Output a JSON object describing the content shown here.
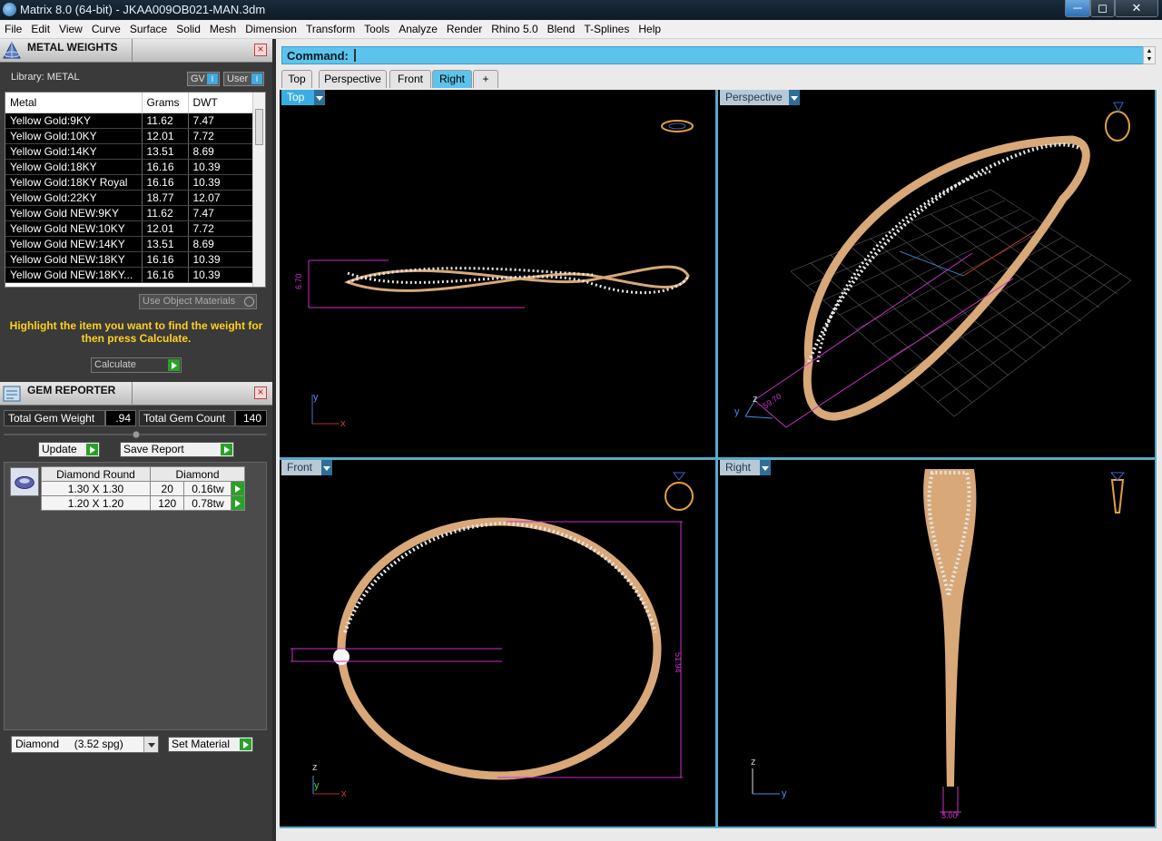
{
  "window": {
    "title": "Matrix 8.0 (64-bit) - JKAA009OB021-MAN.3dm",
    "controls": {
      "minimize": "─",
      "maximize": "◻",
      "close": "✕"
    }
  },
  "menu": [
    "File",
    "Edit",
    "View",
    "Curve",
    "Surface",
    "Solid",
    "Mesh",
    "Dimension",
    "Transform",
    "Tools",
    "Analyze",
    "Render",
    "Rhino 5.0",
    "Blend",
    "T-Splines",
    "Help"
  ],
  "metal_weights": {
    "title": "METAL WEIGHTS",
    "library_label": "Library: METAL",
    "toggle_gv": "GV",
    "toggle_user": "User",
    "toggle_marker": "I",
    "columns": [
      "Metal",
      "Grams",
      "DWT"
    ],
    "rows": [
      [
        "Yellow Gold:9KY",
        "11.62",
        "7.47"
      ],
      [
        "Yellow Gold:10KY",
        "12.01",
        "7.72"
      ],
      [
        "Yellow Gold:14KY",
        "13.51",
        "8.69"
      ],
      [
        "Yellow Gold:18KY",
        "16.16",
        "10.39"
      ],
      [
        "Yellow Gold:18KY Royal",
        "16.16",
        "10.39"
      ],
      [
        "Yellow Gold:22KY",
        "18.77",
        "12.07"
      ],
      [
        "Yellow Gold NEW:9KY",
        "11.62",
        "7.47"
      ],
      [
        "Yellow Gold NEW:10KY",
        "12.01",
        "7.72"
      ],
      [
        "Yellow Gold NEW:14KY",
        "13.51",
        "8.69"
      ],
      [
        "Yellow Gold NEW:18KY",
        "16.16",
        "10.39"
      ],
      [
        "Yellow Gold NEW:18KY...",
        "16.16",
        "10.39"
      ]
    ],
    "use_object_materials": "Use Object Materials",
    "hint": "Highlight the item you want to find the weight for then press Calculate.",
    "calculate": "Calculate"
  },
  "gem_reporter": {
    "title": "GEM REPORTER",
    "total_weight_label": "Total Gem Weight",
    "total_weight_value": ".94",
    "total_count_label": "Total Gem Count",
    "total_count_value": "140",
    "update": "Update",
    "save_report": "Save Report",
    "columns": [
      "Diamond Round",
      "Diamond"
    ],
    "rows": [
      [
        "1.30 X 1.30",
        "20",
        "0.16tw"
      ],
      [
        "1.20 X 1.20",
        "120",
        "0.78tw"
      ]
    ],
    "material_select": "Diamond     (3.52 spg)",
    "set_material": "Set Material"
  },
  "command": {
    "label": "Command:",
    "value": ""
  },
  "view_tabs": [
    "Top",
    "Perspective",
    "Front",
    "Right",
    "+"
  ],
  "active_tab": "Right",
  "viewports": {
    "top": {
      "label": "Top",
      "dim_label": "6.70"
    },
    "perspective": {
      "label": "Perspective",
      "dim_label": "59.70"
    },
    "front": {
      "label": "Front",
      "dim_label": "51.94"
    },
    "right": {
      "label": "Right",
      "dim_label": "3.00"
    }
  },
  "axis_labels": {
    "x": "x",
    "y": "y",
    "z": "z"
  },
  "colors": {
    "accent": "#3aaee0",
    "command_bar": "#5cc4ec",
    "gold": "#d8a878",
    "dimension": "#c832c8",
    "hint": "#ffd21f",
    "go": "#29a129"
  }
}
